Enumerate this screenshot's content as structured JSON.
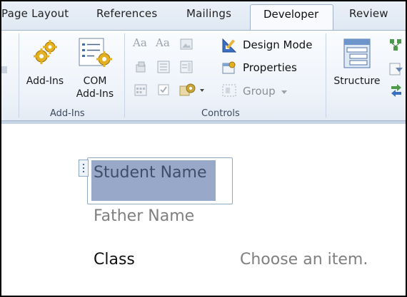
{
  "tabs": [
    "Page Layout",
    "References",
    "Mailings",
    "Developer",
    "Review"
  ],
  "active_tab": "Developer",
  "groups": {
    "addins": {
      "label": "Add-Ins",
      "buttons": {
        "addins": "Add-Ins",
        "com_line1": "COM",
        "com_line2": "Add-Ins"
      }
    },
    "controls": {
      "label": "Controls",
      "design_mode": "Design Mode",
      "properties": "Properties",
      "group": "Group"
    },
    "xml": {
      "structure": "Structure"
    }
  },
  "document": {
    "student_name": "Student Name",
    "father_name": "Father Name",
    "class_label": "Class",
    "class_placeholder": "Choose an item."
  },
  "colors": {
    "ribbon_bg": "#eef3fa",
    "selection": "#97a8c9",
    "placeholder_text": "#7f7f7f"
  }
}
